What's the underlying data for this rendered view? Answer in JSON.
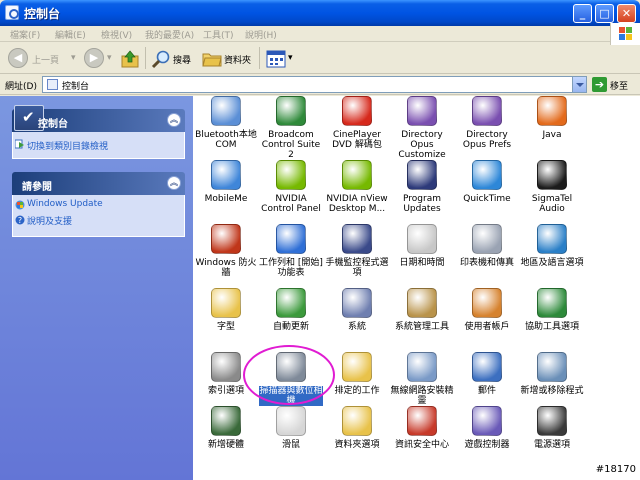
{
  "window": {
    "title": "控制台"
  },
  "menu": [
    "檔案(F)",
    "編輯(E)",
    "檢視(V)",
    "我的最愛(A)",
    "工具(T)",
    "說明(H)"
  ],
  "toolbar": {
    "back_label": "上一頁",
    "search_label": "搜尋",
    "folders_label": "資料夾"
  },
  "address": {
    "label": "網址(D)",
    "value": "控制台",
    "go_label": "移至"
  },
  "sidebar": {
    "panel1": {
      "title": "控制台",
      "link": "切換到類別目錄檢視"
    },
    "panel2": {
      "title": "請參閱",
      "links": [
        "Windows Update",
        "說明及支援"
      ]
    }
  },
  "items": [
    {
      "label": "Bluetooth本地 COM",
      "icon": "bluetooth-icon",
      "color": "#5b8fd6"
    },
    {
      "label": "Broadcom Control Suite 2",
      "icon": "broadcom-icon",
      "color": "#2f8a3a"
    },
    {
      "label": "CinePlayer DVD 解碼包",
      "icon": "cineplayer-icon",
      "color": "#d6291c"
    },
    {
      "label": "Directory Opus Customize",
      "icon": "directory-opus-icon",
      "color": "#7a4fb0"
    },
    {
      "label": "Directory Opus Prefs",
      "icon": "directory-opus-prefs-icon",
      "color": "#7a4fb0"
    },
    {
      "label": "Java",
      "icon": "java-icon",
      "color": "#e36a1b"
    },
    {
      "label": "MobileMe",
      "icon": "mobileme-icon",
      "color": "#3f86d9"
    },
    {
      "label": "NVIDIA Control Panel",
      "icon": "nvidia-icon",
      "color": "#76b900"
    },
    {
      "label": "NVIDIA nView Desktop M...",
      "icon": "nview-icon",
      "color": "#76b900"
    },
    {
      "label": "Program Updates",
      "icon": "program-updates-icon",
      "color": "#2d3a7a"
    },
    {
      "label": "QuickTime",
      "icon": "quicktime-icon",
      "color": "#2d87d8"
    },
    {
      "label": "SigmaTel Audio",
      "icon": "sigmatel-icon",
      "color": "#1c1c1c"
    },
    {
      "label": "Windows 防火牆",
      "icon": "firewall-icon",
      "color": "#c0361a"
    },
    {
      "label": "工作列和 [開始] 功能表",
      "icon": "taskbar-icon",
      "color": "#2f6fd6"
    },
    {
      "label": "手機監控程式選項",
      "icon": "phone-monitor-icon",
      "color": "#3a4a8a"
    },
    {
      "label": "日期和時間",
      "icon": "clock-icon",
      "color": "#c7c7c7"
    },
    {
      "label": "印表機和傳真",
      "icon": "printer-icon",
      "color": "#9aa3b3"
    },
    {
      "label": "地區及語言選項",
      "icon": "globe-icon",
      "color": "#2a7fc7"
    },
    {
      "label": "字型",
      "icon": "fonts-folder-icon",
      "color": "#e8c24a"
    },
    {
      "label": "自動更新",
      "icon": "auto-update-icon",
      "color": "#3c9a3c"
    },
    {
      "label": "系統",
      "icon": "system-icon",
      "color": "#6f7fb0"
    },
    {
      "label": "系統管理工具",
      "icon": "admin-tools-icon",
      "color": "#b9934a"
    },
    {
      "label": "使用者帳戶",
      "icon": "users-icon",
      "color": "#d6822e"
    },
    {
      "label": "協助工具選項",
      "icon": "accessibility-icon",
      "color": "#2d8a3a"
    },
    {
      "label": "索引選項",
      "icon": "indexing-icon",
      "color": "#8a8a8a"
    },
    {
      "label": "掃描器與數位相機",
      "icon": "scanner-icon",
      "color": "#7f8a99"
    },
    {
      "label": "排定的工作",
      "icon": "scheduled-tasks-icon",
      "color": "#e8c24a"
    },
    {
      "label": "無線網路安裝精靈",
      "icon": "wireless-icon",
      "color": "#7a9ac7"
    },
    {
      "label": "郵件",
      "icon": "mail-icon",
      "color": "#3c6fc0"
    },
    {
      "label": "新增或移除程式",
      "icon": "add-remove-icon",
      "color": "#6a8fb8"
    },
    {
      "label": "新增硬體",
      "icon": "add-hardware-icon",
      "color": "#3a6a3a"
    },
    {
      "label": "滑鼠",
      "icon": "mouse-icon",
      "color": "#d6d6d6"
    },
    {
      "label": "資料夾選項",
      "icon": "folder-options-icon",
      "color": "#e8c24a"
    },
    {
      "label": "資訊安全中心",
      "icon": "security-center-icon",
      "color": "#c73a2a"
    },
    {
      "label": "遊戲控制器",
      "icon": "game-controller-icon",
      "color": "#6a5ab8"
    },
    {
      "label": "電源選項",
      "icon": "power-icon",
      "color": "#3a3a3a"
    }
  ],
  "watermark": "#18170"
}
